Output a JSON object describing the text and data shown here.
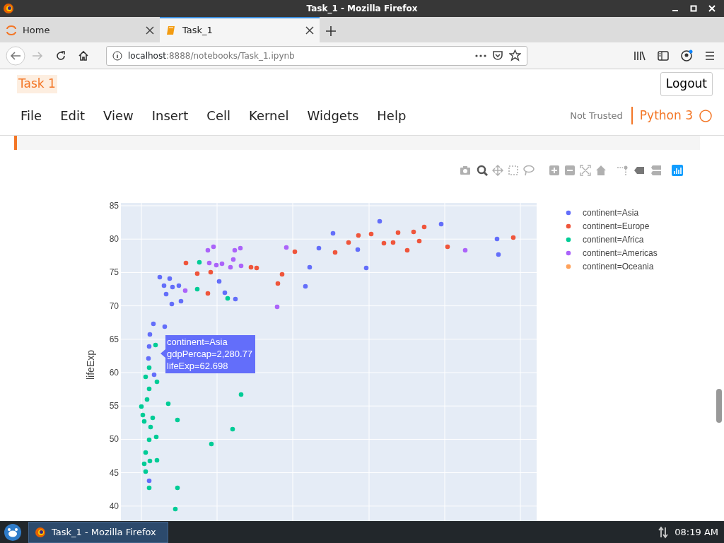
{
  "window": {
    "title": "Task_1 - Mozilla Firefox"
  },
  "tabs": [
    {
      "label": "Home",
      "selected": false,
      "kind": "jupyter"
    },
    {
      "label": "Task_1",
      "selected": true,
      "kind": "notebook"
    }
  ],
  "address_bar": {
    "host": "localhost",
    "path": ":8888/notebooks/Task_1.ipynb"
  },
  "navigation": {
    "forward_disabled": true
  },
  "notebook": {
    "title": "Task 1",
    "logout": "Logout",
    "menu": [
      "File",
      "Edit",
      "View",
      "Insert",
      "Cell",
      "Kernel",
      "Widgets",
      "Help"
    ],
    "trusted_label": "Not Trusted",
    "kernel": "Python 3",
    "kernel_busy": false
  },
  "plot": {
    "y_axis_title": "lifeExp",
    "y_ticks": [
      "85",
      "80",
      "75",
      "70",
      "65",
      "60",
      "55",
      "50",
      "45",
      "40"
    ],
    "legend": [
      {
        "label": "continent=Asia",
        "color": "#636efa"
      },
      {
        "label": "continent=Europe",
        "color": "#ef553b"
      },
      {
        "label": "continent=Africa",
        "color": "#00cc96"
      },
      {
        "label": "continent=Americas",
        "color": "#ab63fa"
      },
      {
        "label": "continent=Oceania",
        "color": "#ffa15a"
      }
    ],
    "tooltip": {
      "lines": [
        "continent=Asia",
        "gdpPercap=2,280.77",
        "lifeExp=62.698"
      ]
    }
  },
  "taskbar": {
    "tasks": [
      {
        "label": "Task_1 - Mozilla Firefox",
        "selected": true
      }
    ],
    "clock": "08:19 AM"
  }
}
